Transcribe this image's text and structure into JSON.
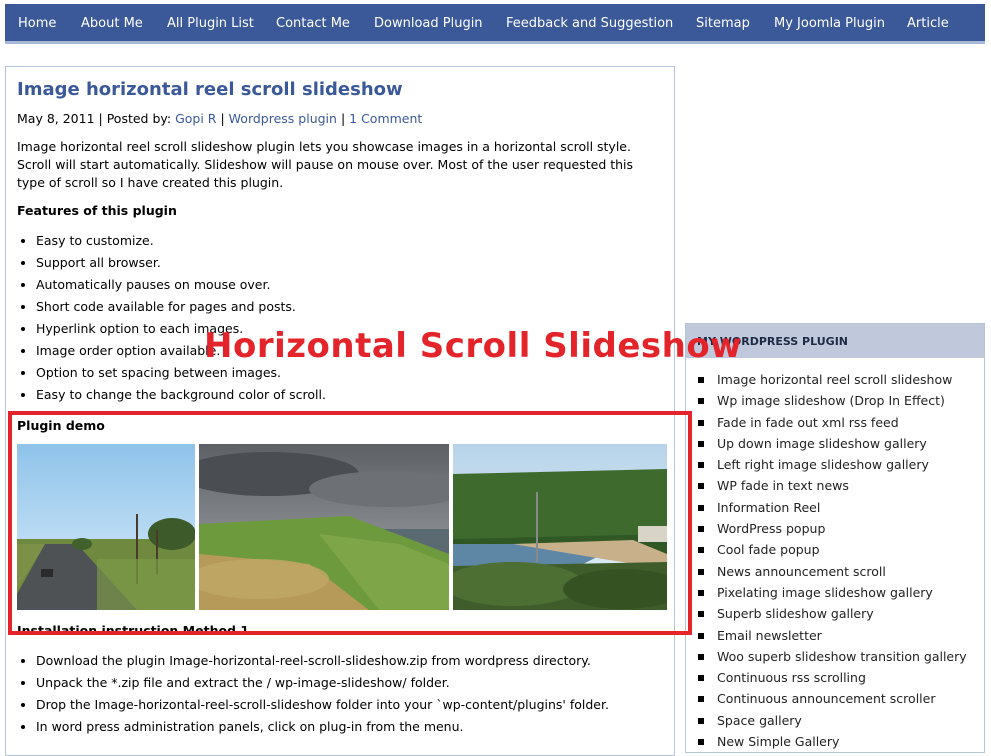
{
  "nav": {
    "items": [
      "Home",
      "About Me",
      "All Plugin List",
      "Contact Me",
      "Download Plugin",
      "Feedback and Suggestion",
      "Sitemap",
      "My Joomla Plugin",
      "Article"
    ]
  },
  "post": {
    "title": "Image horizontal reel scroll slideshow",
    "date": "May 8, 2011",
    "posted_by_prefix": "| Posted by:",
    "author": "Gopi R",
    "category": "Wordpress plugin",
    "comments": "1 Comment",
    "sep": "|",
    "intro": "Image horizontal reel scroll slideshow plugin lets you showcase images in a horizontal scroll style. Scroll will start automatically. Slideshow will pause on mouse over. Most of the user requested this type of scroll so I have created this plugin.",
    "features_heading": "Features of this plugin",
    "features": [
      "Easy to customize.",
      "Support all browser.",
      "Automatically pauses on mouse over.",
      "Short code available for pages and posts.",
      "Hyperlink option to each images.",
      "Image order option available.",
      "Option to set spacing between images.",
      "Easy to change the background color of scroll."
    ],
    "demo_heading": "Plugin demo",
    "install_heading": "Installation instruction Method 1",
    "install_steps": [
      "Download the plugin Image-horizontal-reel-scroll-slideshow.zip from wordpress directory.",
      "Unpack the *.zip file and extract the / wp-image-slideshow/ folder.",
      "Drop the Image-horizontal-reel-scroll-slideshow folder into your `wp-content/plugins' folder.",
      "In word press administration panels, click on plug-in from the menu."
    ]
  },
  "overlay_text": "Horizontal Scroll Slideshow",
  "sidebar": {
    "heading": "MY WORDPRESS PLUGIN",
    "items": [
      "Image horizontal reel scroll slideshow",
      "Wp image slideshow (Drop In Effect)",
      "Fade in fade out xml rss feed",
      "Up down image slideshow gallery",
      "Left right image slideshow gallery",
      "WP fade in text news",
      "Information Reel",
      "WordPress popup",
      "Cool fade popup",
      "News announcement scroll",
      "Pixelating image slideshow gallery",
      "Superb slideshow gallery",
      "Email newsletter",
      "Woo superb slideshow transition gallery",
      "Continuous rss scrolling",
      "Continuous announcement scroller",
      "Space gallery",
      "New Simple Gallery"
    ]
  },
  "colors": {
    "nav_bg": "#3b5998",
    "link": "#3b5998",
    "highlight": "#e3242b",
    "sidebar_head_bg": "#c0c9db"
  }
}
